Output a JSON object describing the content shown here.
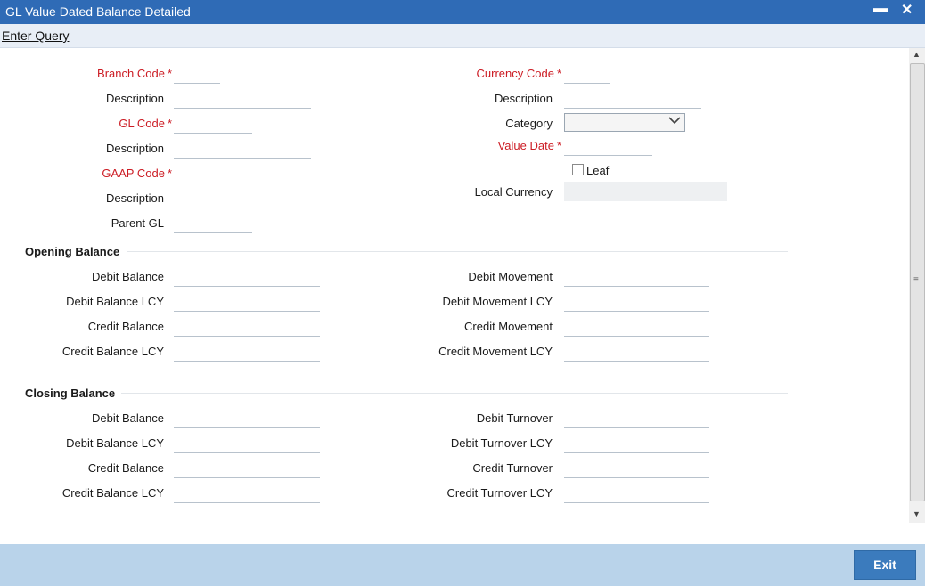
{
  "window": {
    "title": "GL Value Dated Balance Detailed",
    "minimize_glyph": "▬",
    "close_glyph": "✕"
  },
  "menu": {
    "enter_query": "Enter Query"
  },
  "header_form": {
    "branch_code": "Branch Code",
    "branch_desc": "Description",
    "gl_code": "GL Code",
    "gl_desc": "Description",
    "gaap_code": "GAAP Code",
    "gaap_desc": "Description",
    "parent_gl": "Parent GL",
    "currency_code": "Currency Code",
    "currency_desc": "Description",
    "category": "Category",
    "category_value": "",
    "value_date": "Value Date",
    "leaf": "Leaf",
    "local_currency": "Local Currency",
    "required_mark": "*"
  },
  "opening_balance": {
    "title": "Opening Balance",
    "debit_balance": "Debit Balance",
    "debit_balance_lcy": "Debit Balance LCY",
    "credit_balance": "Credit Balance",
    "credit_balance_lcy": "Credit Balance LCY",
    "debit_movement": "Debit Movement",
    "debit_movement_lcy": "Debit Movement LCY",
    "credit_movement": "Credit Movement",
    "credit_movement_lcy": "Credit Movement LCY"
  },
  "closing_balance": {
    "title": "Closing Balance",
    "debit_balance": "Debit Balance",
    "debit_balance_lcy": "Debit Balance LCY",
    "credit_balance": "Credit Balance",
    "credit_balance_lcy": "Credit Balance LCY",
    "debit_turnover": "Debit Turnover",
    "debit_turnover_lcy": "Debit Turnover LCY",
    "credit_turnover": "Credit Turnover",
    "credit_turnover_lcy": "Credit Turnover LCY"
  },
  "footer": {
    "exit_label": "Exit"
  },
  "icons": {
    "minimize": "minimize-icon",
    "close": "close-icon",
    "dropdown": "chevron-down-icon",
    "scroll_up": "scroll-up-icon",
    "scroll_down": "scroll-down-icon"
  },
  "colors": {
    "titlebar": "#2f6bb6",
    "required_label": "#cc1c24",
    "footer": "#b9d3ea",
    "exit_button": "#3b7bbd"
  }
}
